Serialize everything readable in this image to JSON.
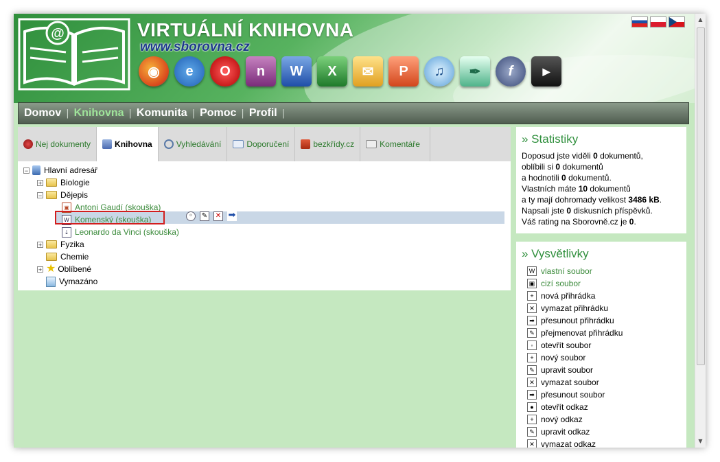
{
  "site": {
    "title": "VIRTUÁLNÍ KNIHOVNA",
    "url": "www.sborovna.cz"
  },
  "flags": [
    "slovak-flag",
    "polish-flag",
    "czech-flag"
  ],
  "apps": [
    "firefox-icon",
    "internet-explorer-icon",
    "opera-icon",
    "onenote-icon",
    "word-icon",
    "excel-icon",
    "outlook-icon",
    "powerpoint-icon",
    "itunes-icon",
    "publisher-icon",
    "flash-icon",
    "avi-video-icon"
  ],
  "nav": [
    {
      "label": "Domov",
      "active": false
    },
    {
      "label": "Knihovna",
      "active": true
    },
    {
      "label": "Komunita",
      "active": false
    },
    {
      "label": "Pomoc",
      "active": false
    },
    {
      "label": "Profil",
      "active": false
    }
  ],
  "nav_separator": "|",
  "tabs": [
    {
      "label": "Nej dokumenty",
      "icon": "award-icon"
    },
    {
      "label": "Knihovna",
      "icon": "library-icon"
    },
    {
      "label": "Vyhledávání",
      "icon": "search-icon"
    },
    {
      "label": "Doporučení",
      "icon": "mail-icon"
    },
    {
      "label": "bezkřídy.cz",
      "icon": "home-icon"
    },
    {
      "label": "Komentáře",
      "icon": "comments-icon"
    }
  ],
  "tree": {
    "root": "Hlavní adresář",
    "biology": "Biologie",
    "history": "Dějepis",
    "doc1": "Antoni Gaudí (skouška)",
    "doc2": "Komenský (skouška)",
    "doc3": "Leonardo da Vinci (skouška)",
    "physics": "Fyzika",
    "chemistry": "Chemie",
    "favorites": "Oblíbené",
    "deleted": "Vymazáno"
  },
  "stats": {
    "title": "» Statistiky",
    "l1a": "Doposud jste viděli ",
    "l1b": "0",
    "l1c": " dokumentů,",
    "l2a": "oblíbili si ",
    "l2b": "0",
    "l2c": " dokumentů",
    "l3a": "a hodnotili ",
    "l3b": "0",
    "l3c": " dokumentů.",
    "l4a": "Vlastních máte ",
    "l4b": "10",
    "l4c": " dokumentů",
    "l5a": "a ty mají dohromady velikost ",
    "l5b": "3486 kB",
    "l5c": ".",
    "l6a": "Napsali jste ",
    "l6b": "0",
    "l6c": " diskusních příspěvků.",
    "l7a": "Váš rating na Sborovně.cz je ",
    "l7b": "0",
    "l7c": "."
  },
  "legend": {
    "title": "» Vysvětlivky",
    "items": [
      {
        "label": "vlastní soubor",
        "icon": "own-file-icon",
        "green": true
      },
      {
        "label": "cizí soubor",
        "icon": "foreign-file-icon",
        "green": true
      },
      {
        "label": "nová přihrádka",
        "icon": "new-folder-icon",
        "green": false
      },
      {
        "label": "vymazat přihrádku",
        "icon": "delete-folder-icon",
        "green": false
      },
      {
        "label": "přesunout přihrádku",
        "icon": "move-folder-icon",
        "green": false
      },
      {
        "label": "přejmenovat přihrádku",
        "icon": "rename-folder-icon",
        "green": false
      },
      {
        "label": "otevřít soubor",
        "icon": "open-file-icon",
        "green": false
      },
      {
        "label": "nový soubor",
        "icon": "new-file-icon",
        "green": false
      },
      {
        "label": "upravit soubor",
        "icon": "edit-file-icon",
        "green": false
      },
      {
        "label": "vymazat soubor",
        "icon": "delete-file-icon",
        "green": false
      },
      {
        "label": "přesunout soubor",
        "icon": "move-file-icon",
        "green": false
      },
      {
        "label": "otevřít odkaz",
        "icon": "open-link-icon",
        "green": false
      },
      {
        "label": "nový odkaz",
        "icon": "new-link-icon",
        "green": false
      },
      {
        "label": "upravit odkaz",
        "icon": "edit-link-icon",
        "green": false
      },
      {
        "label": "vymazat odkaz",
        "icon": "delete-link-icon",
        "green": false
      }
    ]
  },
  "colors": {
    "accent": "#2f8f3c",
    "link_green": "#3a8a3a",
    "selection": "#c9d7e6",
    "highlight_border": "#d21e1e"
  }
}
